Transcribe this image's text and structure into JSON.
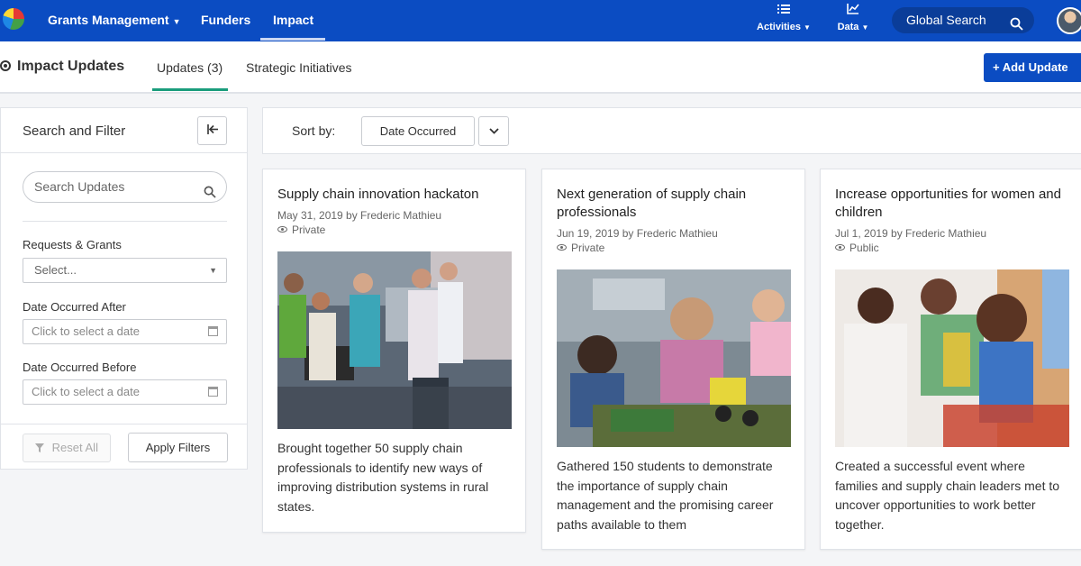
{
  "topnav": {
    "items": [
      {
        "label": "Grants Management",
        "has_caret": true
      },
      {
        "label": "Funders",
        "has_caret": false
      },
      {
        "label": "Impact",
        "has_caret": false
      }
    ],
    "active_item": "Impact",
    "activities_label": "Activities",
    "data_label": "Data",
    "global_search_label": "Global Search",
    "colors": {
      "nav_background": "#0b4cc2",
      "accent": "#1a9d7c"
    }
  },
  "subheader": {
    "title": "Impact Updates",
    "tabs": [
      {
        "label": "Updates (3)",
        "active": true
      },
      {
        "label": "Strategic Initiatives",
        "active": false
      }
    ],
    "add_button_label": "+ Add Update"
  },
  "filter_panel": {
    "title": "Search and Filter",
    "search_placeholder": "Search Updates",
    "requests_label": "Requests & Grants",
    "requests_placeholder": "Select...",
    "after_label": "Date Occurred After",
    "before_label": "Date Occurred Before",
    "date_placeholder": "Click to select a date",
    "reset_label": "Reset All",
    "apply_label": "Apply Filters"
  },
  "sortbar": {
    "label": "Sort by:",
    "selected": "Date Occurred"
  },
  "cards": [
    {
      "title": "Supply chain innovation hackaton",
      "meta": "May 31, 2019 by Frederic Mathieu",
      "visibility": "Private",
      "description": "Brought together 50 supply chain professionals to identify new ways of improving distribution systems in rural states."
    },
    {
      "title": "Next generation of supply chain professionals",
      "meta": "Jun 19, 2019 by Frederic Mathieu",
      "visibility": "Private",
      "description": "Gathered 150 students to demonstrate the importance of supply chain management and the promising career paths available to them"
    },
    {
      "title": "Increase opportunities for women and children",
      "meta": "Jul 1, 2019 by Frederic Mathieu",
      "visibility": "Public",
      "description": "Created a successful event where families and supply chain leaders met to uncover opportunities to work better together."
    }
  ]
}
